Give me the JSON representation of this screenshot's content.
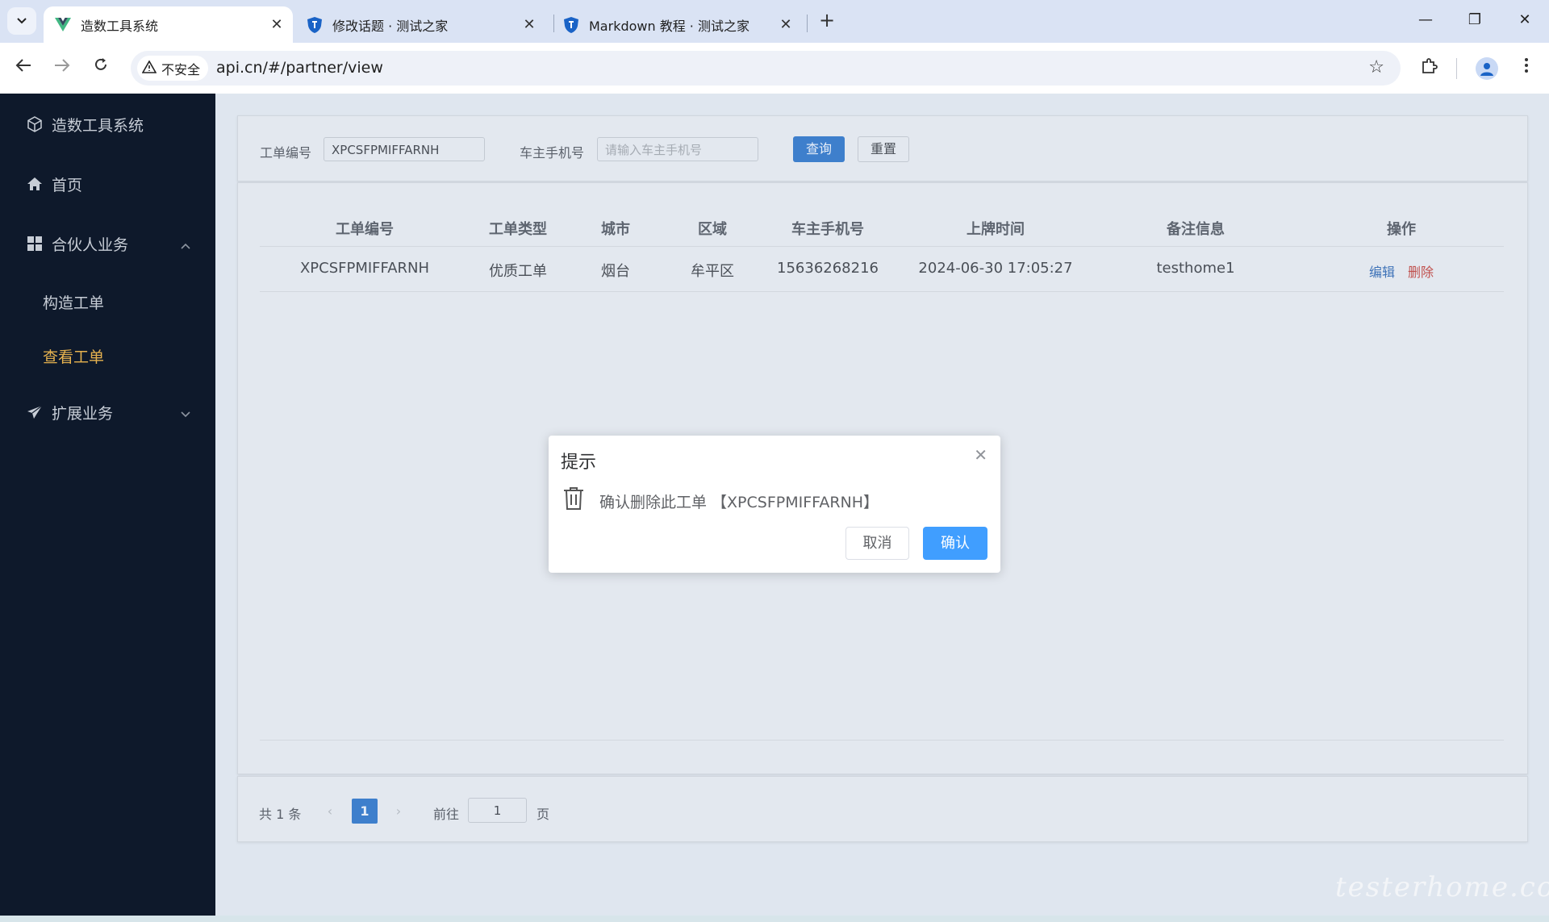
{
  "browser": {
    "tabs": [
      {
        "title": "造数工具系统",
        "active": true
      },
      {
        "title": "修改话题 · 测试之家",
        "active": false
      },
      {
        "title": "Markdown 教程 · 测试之家",
        "active": false
      }
    ],
    "security_label": "不安全",
    "url": "api.cn/#/partner/view"
  },
  "sidebar": {
    "logo_label": "造数工具系统",
    "items": [
      {
        "label": "首页",
        "icon": "home-icon"
      },
      {
        "label": "合伙人业务",
        "icon": "grid-icon",
        "expanded": true,
        "children": [
          {
            "label": "构造工单",
            "active": false
          },
          {
            "label": "查看工单",
            "active": true
          }
        ]
      },
      {
        "label": "扩展业务",
        "icon": "send-icon",
        "expanded": false
      }
    ]
  },
  "search": {
    "order_no_label": "工单编号",
    "order_no_value": "XPCSFPMIFFARNH",
    "phone_label": "车主手机号",
    "phone_placeholder": "请输入车主手机号",
    "query_button": "查询",
    "reset_button": "重置"
  },
  "table": {
    "columns": [
      "工单编号",
      "工单类型",
      "城市",
      "区域",
      "车主手机号",
      "上牌时间",
      "备注信息",
      "操作"
    ],
    "rows": [
      [
        "XPCSFPMIFFARNH",
        "优质工单",
        "烟台",
        "牟平区",
        "15636268216",
        "2024-06-30 17:05:27",
        "testhome1"
      ]
    ],
    "actions": {
      "edit": "编辑",
      "delete": "删除"
    }
  },
  "pagination": {
    "total_text": "共 1 条",
    "current_page": "1",
    "goto_label": "前往",
    "goto_value": "1",
    "page_suffix": "页"
  },
  "dialog": {
    "title": "提示",
    "message": "确认删除此工单 【XPCSFPMIFFARNH】",
    "cancel": "取消",
    "confirm": "确认"
  },
  "watermark": "testerhome.com",
  "colors": {
    "sidebar_bg": "#0e192b",
    "sidebar_active": "#e6b24f",
    "primary": "#409eff",
    "danger_link": "#c0504d"
  }
}
